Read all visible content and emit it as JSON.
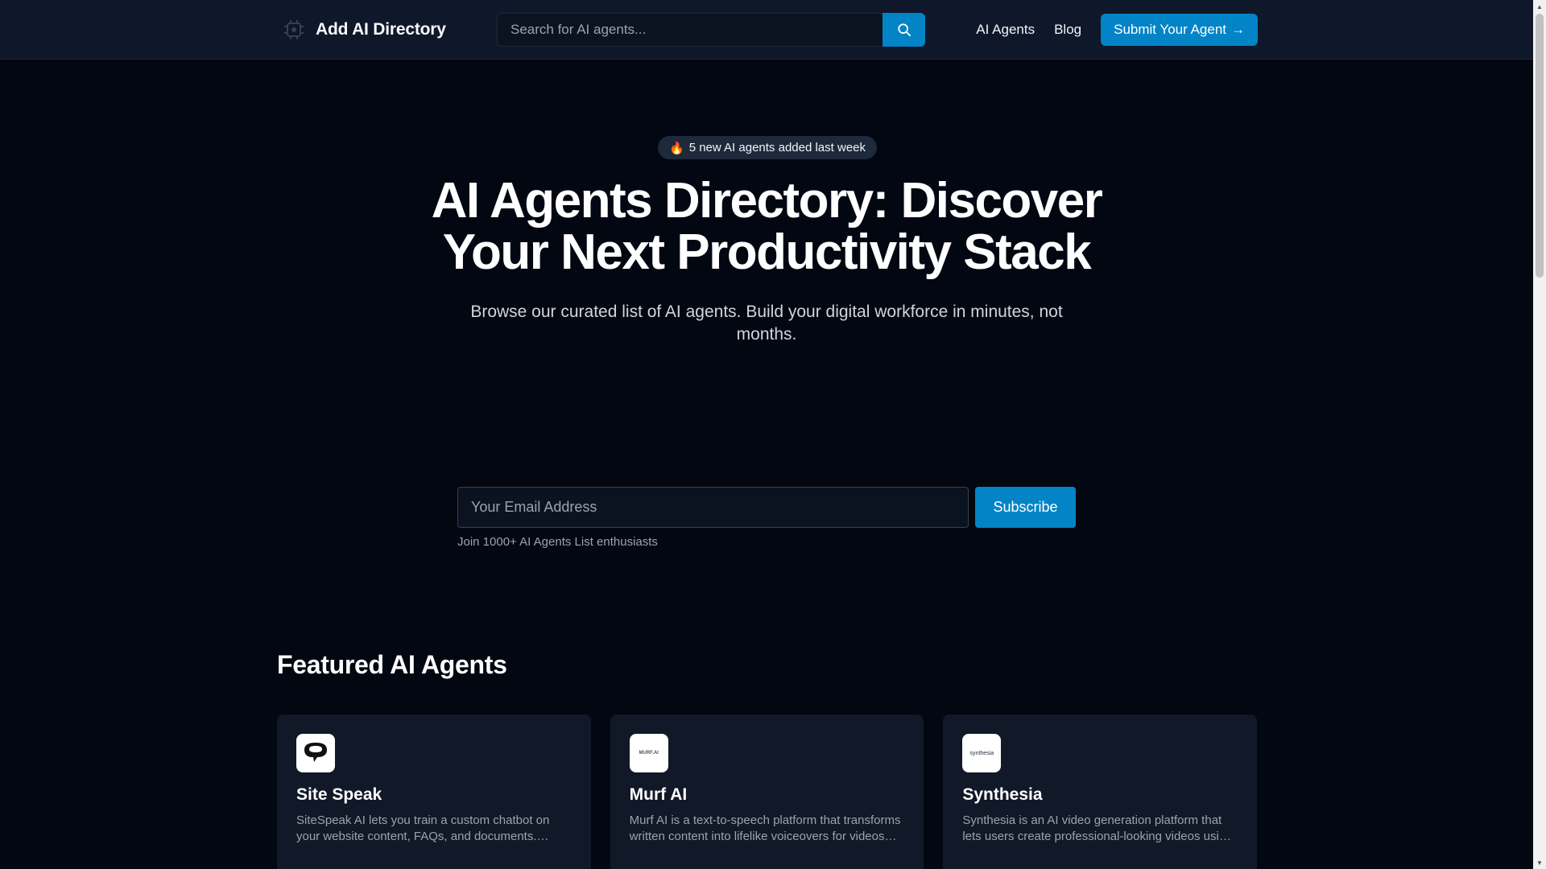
{
  "header": {
    "brand_name": "Add AI Directory",
    "search_placeholder": "Search for AI agents...",
    "nav": [
      {
        "label": "AI Agents"
      },
      {
        "label": "Blog"
      }
    ],
    "submit_label": "Submit Your Agent",
    "submit_arrow": "→"
  },
  "hero": {
    "badge_emoji": "🔥",
    "badge_text": "5 new AI agents added last week",
    "title_line1": "AI Agents Directory: Discover",
    "title_line2": "Your Next Productivity Stack",
    "subtitle": "Browse our curated list of AI agents. Build your digital workforce in minutes, not months."
  },
  "subscribe": {
    "email_placeholder": "Your Email Address",
    "button_label": "Subscribe",
    "note": "Join 1000+ AI Agents List enthusiasts"
  },
  "featured": {
    "title": "Featured AI Agents",
    "cards": [
      {
        "name": "Site Speak",
        "description": "SiteSpeak AI lets you train a custom chatbot on your website content, FAQs, and documents. SiteSpeak AI then answers your visitors' questions."
      },
      {
        "name": "Murf AI",
        "logo_text": "MURF.AI",
        "description": "Murf AI is a text-to-speech platform that transforms written content into lifelike voiceovers for videos and presentations."
      },
      {
        "name": "Synthesia",
        "logo_text": "synthesia",
        "description": "Synthesia is an AI video generation platform that lets users create professional-looking videos using AI avatars."
      }
    ]
  },
  "colors": {
    "background": "#030712",
    "header_bg": "#0f172a",
    "accent": "#0284c7",
    "card_bg": "#111827"
  }
}
